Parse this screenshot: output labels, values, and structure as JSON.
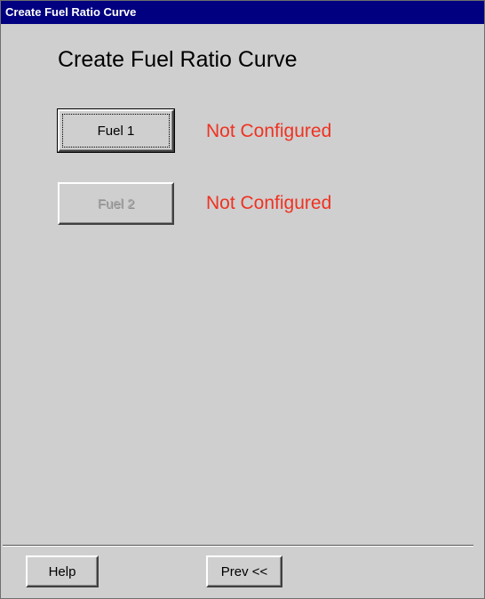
{
  "window": {
    "title": "Create Fuel Ratio Curve"
  },
  "main": {
    "heading": "Create Fuel Ratio Curve",
    "fuels": [
      {
        "button_label": "Fuel 1",
        "status": "Not Configured",
        "enabled": true
      },
      {
        "button_label": "Fuel 2",
        "status": "Not Configured",
        "enabled": false
      }
    ]
  },
  "footer": {
    "help_label": "Help",
    "prev_label": "Prev <<"
  },
  "colors": {
    "titlebar": "#000080",
    "background": "#cfcfcf",
    "status": "#ee3322"
  }
}
